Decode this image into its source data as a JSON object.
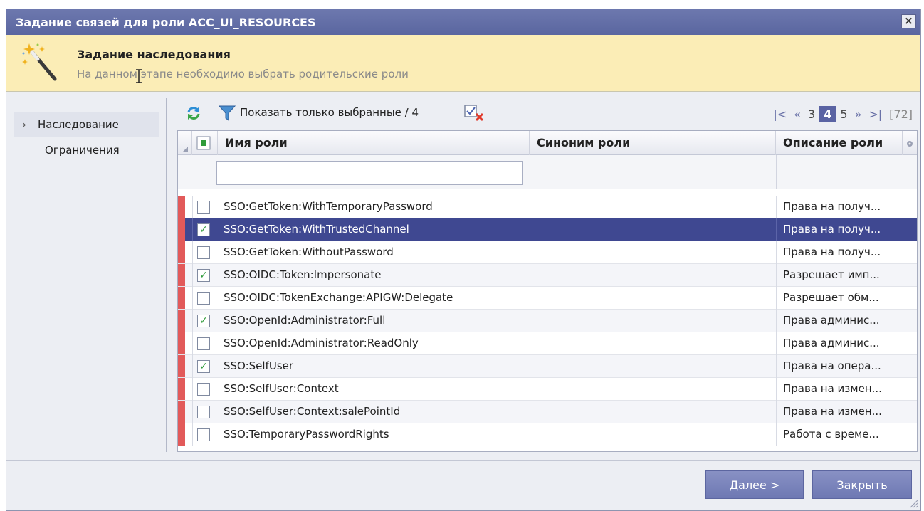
{
  "window": {
    "title": "Задание связей для роли ACC_UI_RESOURCES",
    "close_label": "×"
  },
  "wizard": {
    "step_title": "Задание наследования",
    "step_desc": "На данном этапе необходимо выбрать родительские роли"
  },
  "sidebar": {
    "items": [
      {
        "label": "Наследование",
        "active": true
      },
      {
        "label": "Ограничения",
        "active": false
      }
    ]
  },
  "toolbar": {
    "show_selected_label": "Показать только выбранные / 4"
  },
  "pager": {
    "first": "|<",
    "prev": "«",
    "pages": [
      "3",
      "4",
      "5"
    ],
    "current": "4",
    "next": "»",
    "last": ">|",
    "total": "[72]"
  },
  "grid": {
    "columns": {
      "name": "Имя роли",
      "synonym": "Синоним роли",
      "description": "Описание роли"
    },
    "rows": [
      {
        "name": "SSO:GetToken:WithTemporaryPassword",
        "synonym": "",
        "description": "Права на получ...",
        "checked": false
      },
      {
        "name": "SSO:GetToken:WithTrustedChannel",
        "synonym": "",
        "description": "Права на получ...",
        "checked": true
      },
      {
        "name": "SSO:GetToken:WithoutPassword",
        "synonym": "",
        "description": "Права на получ...",
        "checked": false
      },
      {
        "name": "SSO:OIDC:Token:Impersonate",
        "synonym": "",
        "description": "Разрешает имп...",
        "checked": true
      },
      {
        "name": "SSO:OIDC:TokenExchange:APIGW:Delegate",
        "synonym": "",
        "description": "Разрешает обм...",
        "checked": false
      },
      {
        "name": "SSO:OpenId:Administrator:Full",
        "synonym": "",
        "description": "Права админис...",
        "checked": true
      },
      {
        "name": "SSO:OpenId:Administrator:ReadOnly",
        "synonym": "",
        "description": "Права админис...",
        "checked": false
      },
      {
        "name": "SSO:SelfUser",
        "synonym": "",
        "description": "Права на опера...",
        "checked": true
      },
      {
        "name": "SSO:SelfUser:Context",
        "synonym": "",
        "description": "Права на измен...",
        "checked": false
      },
      {
        "name": "SSO:SelfUser:Context:salePointId",
        "synonym": "",
        "description": "Права на измен...",
        "checked": false
      },
      {
        "name": "SSO:TemporaryPasswordRights",
        "synonym": "",
        "description": "Работа с време...",
        "checked": false
      }
    ]
  },
  "buttons": {
    "next": "Далее >",
    "close": "Закрыть"
  },
  "colors": {
    "titlebar": "#5f6ba3",
    "selected_row": "#3f4891",
    "header_band": "#fbedb6",
    "row_marker": "#e25a5a",
    "button": "#7c85bd"
  }
}
